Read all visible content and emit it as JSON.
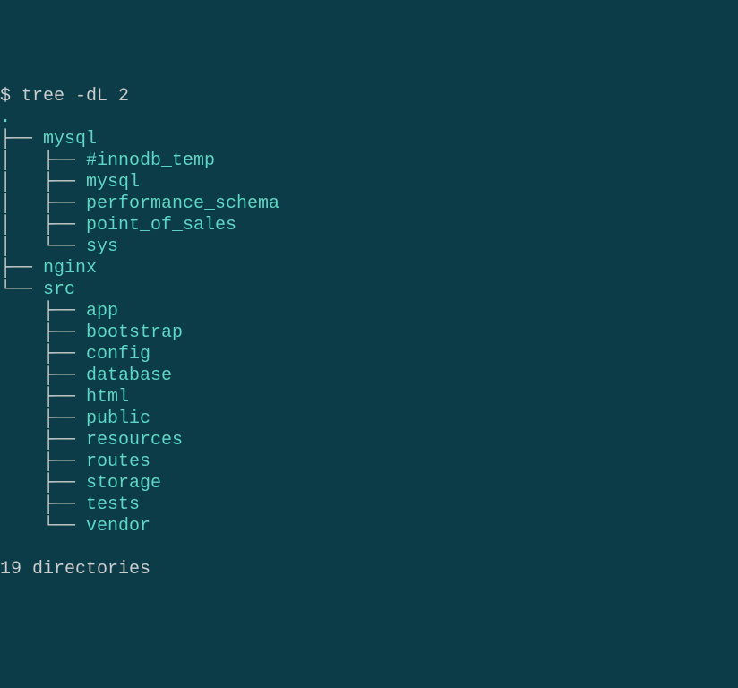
{
  "prompt": "$ ",
  "command": "tree -dL 2",
  "root": ".",
  "tree": [
    {
      "prefix": "├── ",
      "name": "mysql"
    },
    {
      "prefix": "│   ├── ",
      "name": "#innodb_temp"
    },
    {
      "prefix": "│   ├── ",
      "name": "mysql"
    },
    {
      "prefix": "│   ├── ",
      "name": "performance_schema"
    },
    {
      "prefix": "│   ├── ",
      "name": "point_of_sales"
    },
    {
      "prefix": "│   └── ",
      "name": "sys"
    },
    {
      "prefix": "├── ",
      "name": "nginx"
    },
    {
      "prefix": "└── ",
      "name": "src"
    },
    {
      "prefix": "    ├── ",
      "name": "app"
    },
    {
      "prefix": "    ├── ",
      "name": "bootstrap"
    },
    {
      "prefix": "    ├── ",
      "name": "config"
    },
    {
      "prefix": "    ├── ",
      "name": "database"
    },
    {
      "prefix": "    ├── ",
      "name": "html"
    },
    {
      "prefix": "    ├── ",
      "name": "public"
    },
    {
      "prefix": "    ├── ",
      "name": "resources"
    },
    {
      "prefix": "    ├── ",
      "name": "routes"
    },
    {
      "prefix": "    ├── ",
      "name": "storage"
    },
    {
      "prefix": "    ├── ",
      "name": "tests"
    },
    {
      "prefix": "    └── ",
      "name": "vendor"
    }
  ],
  "summary": "19 directories"
}
